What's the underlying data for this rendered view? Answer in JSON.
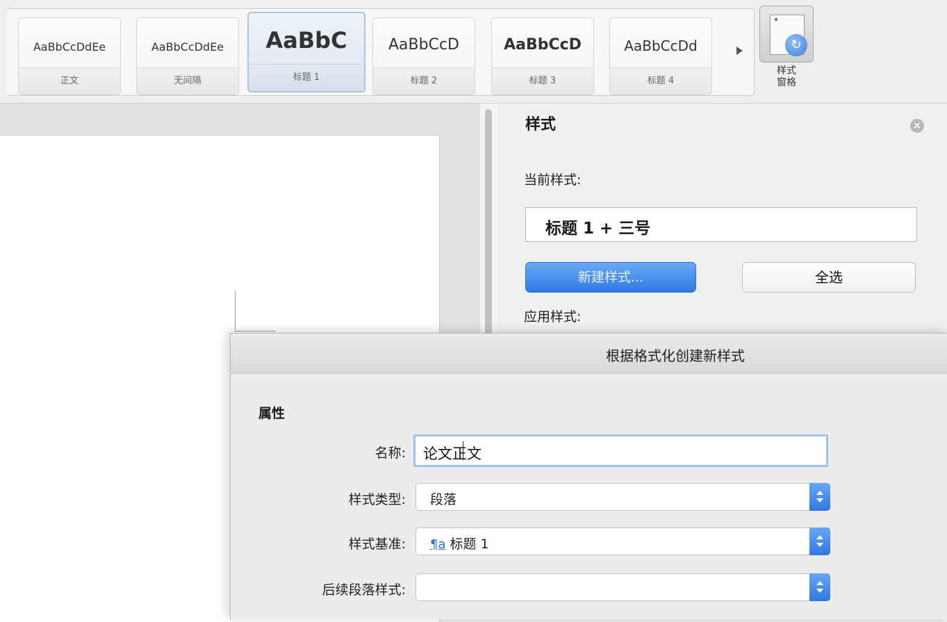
{
  "ribbon": {
    "styles": [
      {
        "sample": "AaBbCcDdEe",
        "name": "正文"
      },
      {
        "sample": "AaBbCcDdEe",
        "name": "无间隔"
      },
      {
        "sample": "AaBbC",
        "name": "标题 1"
      },
      {
        "sample": "AaBbCcD",
        "name": "标题 2"
      },
      {
        "sample": "AaBbCcD",
        "name": "标题 3"
      },
      {
        "sample": "AaBbCcDd",
        "name": "标题 4"
      }
    ],
    "styles_pane_button": {
      "line1": "样式",
      "line2": "窗格"
    }
  },
  "styles_pane": {
    "title": "样式",
    "current_style_label": "当前样式:",
    "current_style_value": "标题 1 + 三号",
    "new_style_button": "新建样式...",
    "select_all_button": "全选",
    "apply_style_label": "应用样式:"
  },
  "dialog": {
    "title": "根据格式化创建新样式",
    "section": "属性",
    "name_label": "名称:",
    "name_value": "论文正文",
    "style_type_label": "样式类型:",
    "style_type_value": "段落",
    "based_on_label": "样式基准:",
    "based_on_icon": "¶a",
    "based_on_value": "标题 1",
    "next_style_label": "后续段落样式:",
    "next_style_value": ""
  },
  "colors": {
    "accent": "#2f79e4",
    "focus_ring": "#9fc3ee"
  }
}
